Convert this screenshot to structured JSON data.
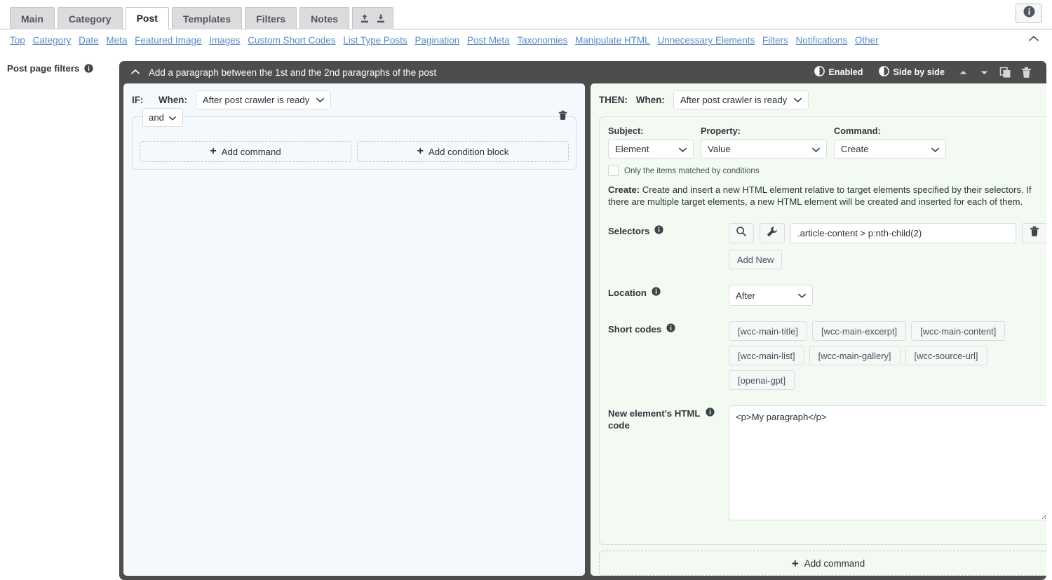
{
  "colors": {
    "tab_inactive_bg": "#dcdcde",
    "tab_active_bg": "#ffffff",
    "link_blue": "#5a8ac6",
    "frame_dark": "#4d4d4d",
    "if_panel_bg": "#f3f9fd",
    "then_panel_bg": "#f2faf2",
    "text": "#32373c"
  },
  "tabbar": {
    "tabs": [
      {
        "label": "Main",
        "active": false
      },
      {
        "label": "Category",
        "active": false
      },
      {
        "label": "Post",
        "active": true
      },
      {
        "label": "Templates",
        "active": false
      },
      {
        "label": "Filters",
        "active": false
      },
      {
        "label": "Notes",
        "active": false
      }
    ],
    "icon_tab": {
      "upload_icon": "upload-icon",
      "download_icon": "download-icon"
    },
    "info_icon": "info-icon"
  },
  "subnav": {
    "links": [
      "Top",
      "Category",
      "Date",
      "Meta",
      "Featured Image",
      "Images",
      "Custom Short Codes",
      "List Type Posts",
      "Pagination",
      "Post Meta",
      "Taxonomies",
      "Manipulate HTML",
      "Unnecessary Elements",
      "Filters",
      "Notifications",
      "Other"
    ],
    "collapse_icon": "chevron-up-icon"
  },
  "sidebar": {
    "label": "Post page filters",
    "info_icon": "info-icon"
  },
  "filter": {
    "collapse_icon": "chevron-up-icon",
    "title": "Add a paragraph between the 1st and the 2nd paragraphs of the post",
    "toolbar": {
      "enabled_label": "Enabled",
      "enabled_icon": "toggle-on-icon",
      "side_by_side_label": "Side by side",
      "side_by_side_icon": "toggle-on-icon",
      "move_up_icon": "caret-up-icon",
      "move_down_icon": "caret-down-icon",
      "duplicate_icon": "duplicate-icon",
      "delete_icon": "trash-icon"
    }
  },
  "if_panel": {
    "label": "IF:",
    "when_label": "When:",
    "when_value": "After post crawler is ready",
    "when_caret_icon": "chevron-down-icon",
    "condition_block": {
      "operator_value": "and",
      "operator_caret_icon": "chevron-down-icon",
      "delete_icon": "trash-icon",
      "add_command_label": "Add command",
      "add_condition_block_label": "Add condition block"
    }
  },
  "then_panel": {
    "label": "THEN:",
    "when_label": "When:",
    "when_value": "After post crawler is ready",
    "when_caret_icon": "chevron-down-icon",
    "subject": {
      "label": "Subject:",
      "value": "Element"
    },
    "property": {
      "label": "Property:",
      "value": "Value"
    },
    "command": {
      "label": "Command:",
      "value": "Create"
    },
    "only_matched": {
      "label": "Only the items matched by conditions",
      "checked": false
    },
    "description_title": "Create:",
    "description_text": " Create and insert a new HTML element relative to target elements specified by their selectors. If there are multiple target elements, a new HTML element will be created and inserted for each of them.",
    "selectors": {
      "label": "Selectors",
      "info_icon": "info-icon",
      "search_icon": "magnifier-icon",
      "wrench_icon": "wrench-icon",
      "value": ".article-content > p:nth-child(2)",
      "placeholder": "",
      "delete_icon": "trash-icon",
      "add_new_label": "Add New"
    },
    "location": {
      "label": "Location",
      "info_icon": "info-icon",
      "value": "After",
      "caret_icon": "chevron-down-icon"
    },
    "short_codes": {
      "label": "Short codes",
      "info_icon": "info-icon",
      "chips": [
        "[wcc-main-title]",
        "[wcc-main-excerpt]",
        "[wcc-main-content]",
        "[wcc-main-list]",
        "[wcc-main-gallery]",
        "[wcc-source-url]",
        "[openai-gpt]"
      ]
    },
    "html_code": {
      "label": "New element's HTML code",
      "info_icon": "info-icon",
      "value": "<p>My paragraph</p>",
      "placeholder": ""
    },
    "add_command_label": "Add command",
    "add_command_plus": "+"
  }
}
